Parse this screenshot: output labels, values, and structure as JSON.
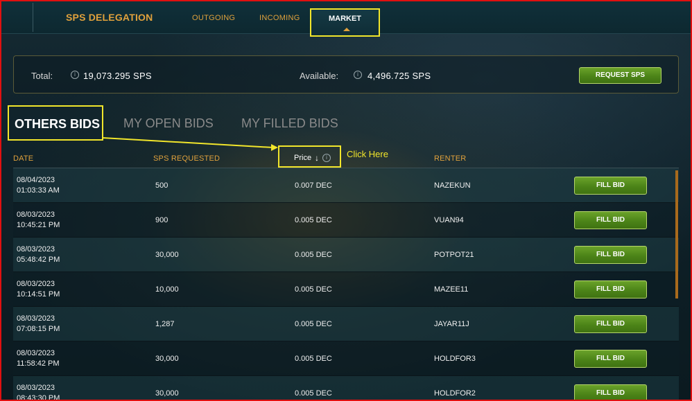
{
  "nav": {
    "brand": "SPS DELEGATION",
    "outgoing": "OUTGOING",
    "incoming": "INCOMING",
    "market": "MARKET"
  },
  "summary": {
    "total_label": "Total:",
    "total_value": "19,073.295 SPS",
    "available_label": "Available:",
    "available_value": "4,496.725 SPS",
    "request_button": "REQUEST SPS"
  },
  "tabs": {
    "others": "OTHERS BIDS",
    "open": "MY OPEN BIDS",
    "filled": "MY FILLED BIDS"
  },
  "annotation": {
    "text": "Click Here"
  },
  "table": {
    "headers": {
      "date": "DATE",
      "sps": "SPS REQUESTED",
      "price": "Price",
      "sort_arrow": "↓",
      "renter": "RENTER"
    },
    "rows": [
      {
        "date": "08/04/2023",
        "time": "01:03:33 AM",
        "sps": "500",
        "price": "0.007 DEC",
        "renter": "NAZEKUN",
        "action": "FILL BID"
      },
      {
        "date": "08/03/2023",
        "time": "10:45:21 PM",
        "sps": "900",
        "price": "0.005 DEC",
        "renter": "VUAN94",
        "action": "FILL BID"
      },
      {
        "date": "08/03/2023",
        "time": "05:48:42 PM",
        "sps": "30,000",
        "price": "0.005 DEC",
        "renter": "POTPOT21",
        "action": "FILL BID"
      },
      {
        "date": "08/03/2023",
        "time": "10:14:51 PM",
        "sps": "10,000",
        "price": "0.005 DEC",
        "renter": "MAZEE11",
        "action": "FILL BID"
      },
      {
        "date": "08/03/2023",
        "time": "07:08:15 PM",
        "sps": "1,287",
        "price": "0.005 DEC",
        "renter": "JAYAR11J",
        "action": "FILL BID"
      },
      {
        "date": "08/03/2023",
        "time": "11:58:42 PM",
        "sps": "30,000",
        "price": "0.005 DEC",
        "renter": "HOLDFOR3",
        "action": "FILL BID"
      },
      {
        "date": "08/03/2023",
        "time": "08:43:30 PM",
        "sps": "30,000",
        "price": "0.005 DEC",
        "renter": "HOLDFOR2",
        "action": "FILL BID"
      }
    ]
  },
  "icons": {
    "info": "i"
  },
  "colors": {
    "accent_gold": "#e0a13c",
    "highlight_yellow": "#f2e62b",
    "button_green": "#4c8418",
    "frame_red": "#e01010"
  }
}
